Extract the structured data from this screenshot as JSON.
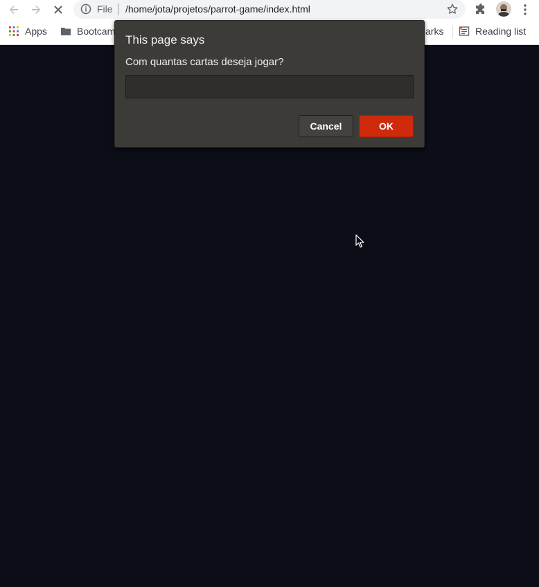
{
  "browser": {
    "omnibox": {
      "scheme_label": "File",
      "url": "/home/jota/projetos/parrot-game/index.html"
    },
    "bookmarks": [
      {
        "label": "Apps",
        "icon": "apps-grid-icon"
      },
      {
        "label": "Bootcam",
        "icon": "folder-icon"
      },
      {
        "label": "arks",
        "icon": "folder-icon"
      },
      {
        "label": "Reading list",
        "icon": "reading-list-icon"
      }
    ]
  },
  "dialog": {
    "title": "This page says",
    "message": "Com quantas cartas deseja jogar?",
    "input_value": "",
    "cancel_label": "Cancel",
    "ok_label": "OK"
  },
  "colors": {
    "page_background": "#0b0e16",
    "dialog_background": "#3d3b38",
    "ok_button": "#d02a0c"
  }
}
